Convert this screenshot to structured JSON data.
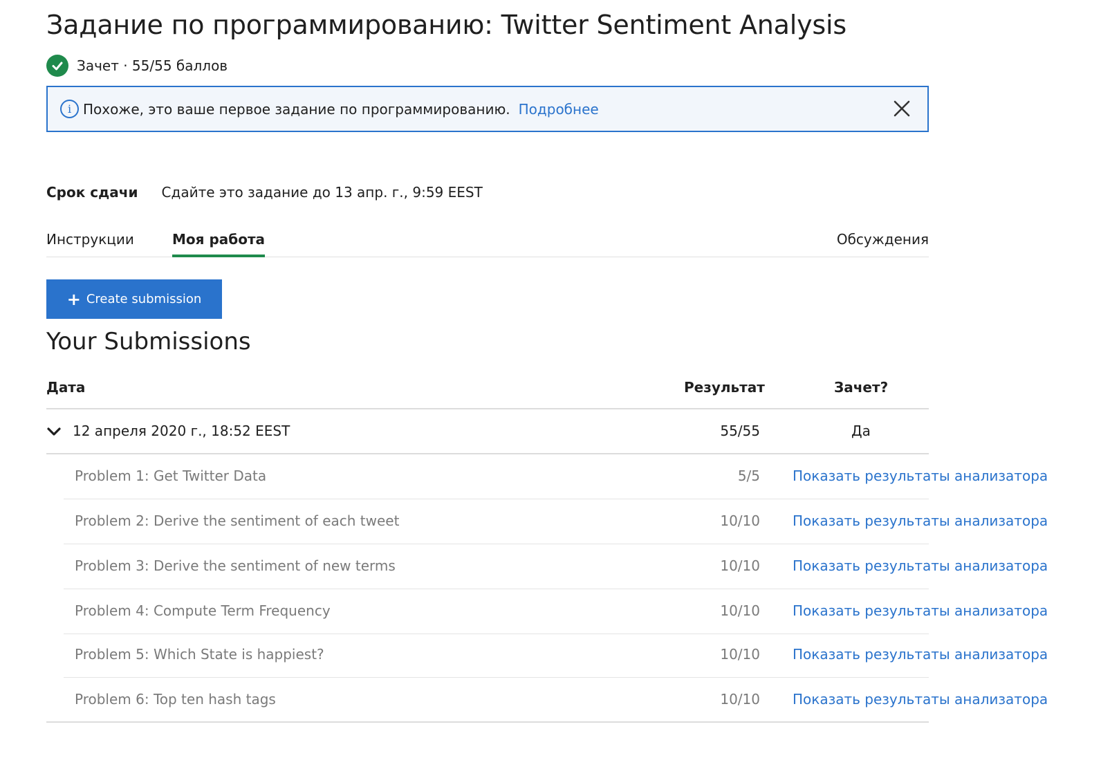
{
  "page": {
    "title": "Задание по программированию: Twitter Sentiment Analysis",
    "grade_text": "Зачет · 55/55 баллов"
  },
  "banner": {
    "message": "Похоже, это ваше первое задание по программированию.",
    "link_label": "Подробнее"
  },
  "deadline": {
    "label": "Срок сдачи",
    "text": "Сдайте это задание до 13 апр. г., 9:59 EEST"
  },
  "tabs": [
    {
      "label": "Инструкции",
      "active": false
    },
    {
      "label": "Моя работа",
      "active": true
    },
    {
      "label": "Обсуждения",
      "active": false
    }
  ],
  "actions": {
    "create_label": "Create submission"
  },
  "submissions": {
    "title": "Your Submissions",
    "columns": {
      "date": "Дата",
      "result": "Результат",
      "passed": "Зачет?"
    },
    "entry": {
      "date": "12 апреля 2020 г., 18:52 EEST",
      "score": "55/55",
      "passed": "Да"
    },
    "problems": [
      {
        "name": "Problem 1: Get Twitter Data",
        "score": "5/5",
        "link": "Показать результаты анализатора"
      },
      {
        "name": "Problem 2: Derive the sentiment of each tweet",
        "score": "10/10",
        "link": "Показать результаты анализатора"
      },
      {
        "name": "Problem 3: Derive the sentiment of new terms",
        "score": "10/10",
        "link": "Показать результаты анализатора"
      },
      {
        "name": "Problem 4: Compute Term Frequency",
        "score": "10/10",
        "link": "Показать результаты анализатора"
      },
      {
        "name": "Problem 5: Which State is happiest?",
        "score": "10/10",
        "link": "Показать результаты анализатора"
      },
      {
        "name": "Problem 6: Top ten hash tags",
        "score": "10/10",
        "link": "Показать результаты анализатора"
      }
    ]
  },
  "colors": {
    "accent_blue": "#2a73cc",
    "success_green": "#1f8a4c",
    "muted_text": "#7a7a7a"
  },
  "icons": [
    "check-circle-icon",
    "info-icon",
    "close-icon",
    "plus-icon",
    "chevron-down-icon"
  ]
}
